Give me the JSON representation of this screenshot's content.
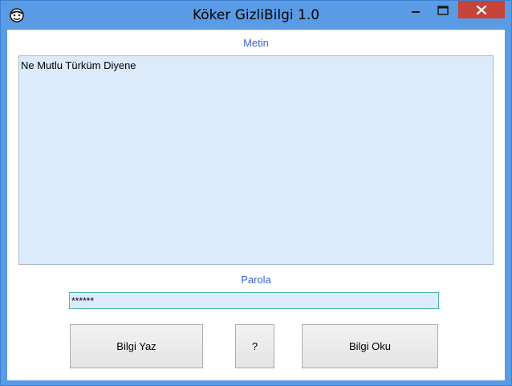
{
  "window": {
    "title": "Köker GizliBilgi 1.0",
    "accent_color": "#5a9be6",
    "close_color": "#c7443a",
    "icon": "app-face-icon",
    "controls": {
      "minimize_icon": "minimize-icon",
      "maximize_icon": "maximize-icon",
      "close_icon": "close-icon"
    }
  },
  "form": {
    "metin_label": "Metin",
    "metin_value": "Ne Mutlu Türküm Diyene",
    "parola_label": "Parola",
    "parola_value": "******",
    "label_color": "#3c63d8",
    "field_background": "#dcebfc"
  },
  "buttons": {
    "write_label": "Bilgi Yaz",
    "help_label": "?",
    "read_label": "Bilgi Oku"
  }
}
